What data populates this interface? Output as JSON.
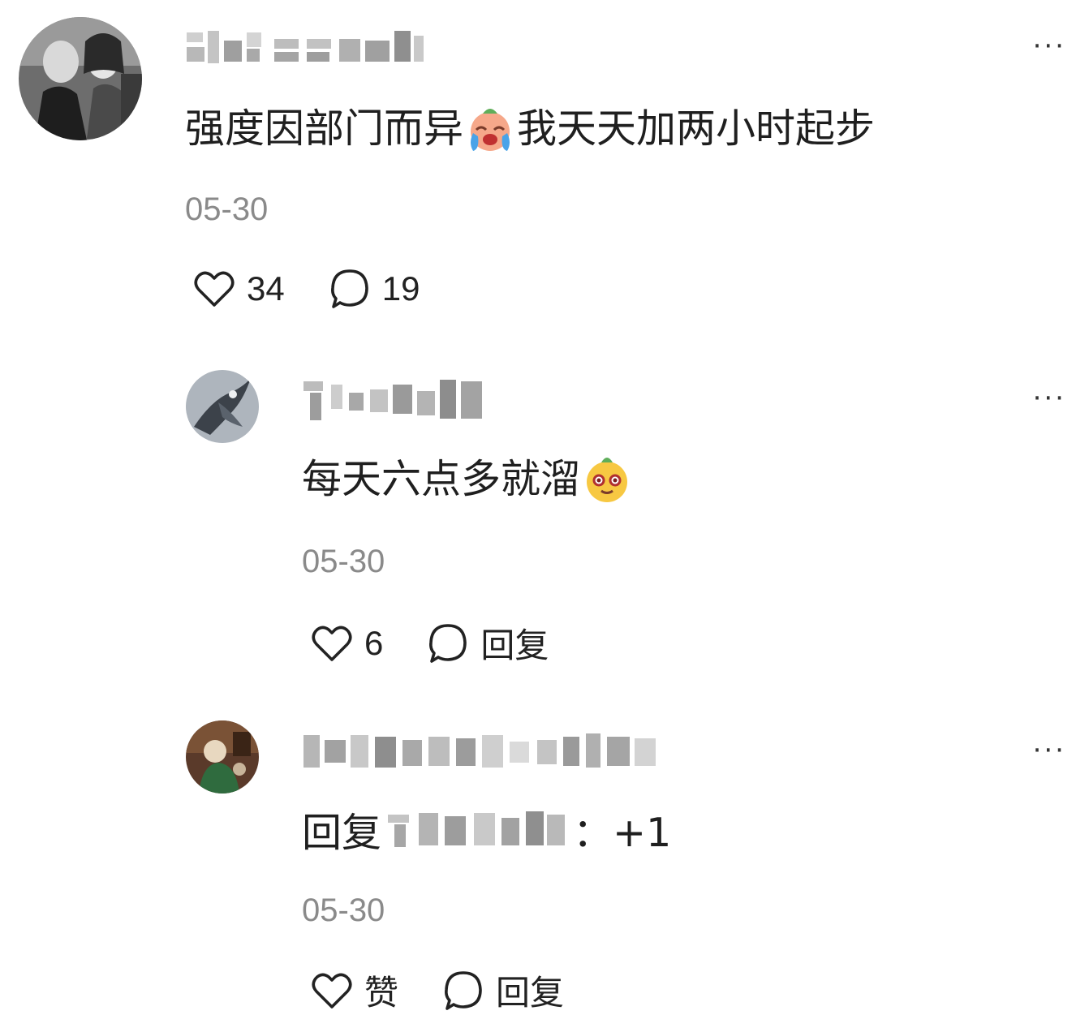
{
  "comments": [
    {
      "avatar_icon": "avatar-bw-photo",
      "text_before_emoji": "强度因部门而异",
      "emoji": "crying-face-emoji",
      "text_after_emoji": "我天天加两小时起步",
      "date": "05-30",
      "like_count": "34",
      "reply_count": "19",
      "more_label": "···"
    },
    {
      "avatar_icon": "avatar-dragon",
      "text_before_emoji": "每天六点多就溜",
      "emoji": "sly-face-emoji",
      "date": "05-30",
      "like_count": "6",
      "reply_label": "回复",
      "more_label": "···"
    },
    {
      "avatar_icon": "avatar-figure",
      "reply_prefix": "回复",
      "reply_suffix": "：+1",
      "date": "05-30",
      "like_label": "赞",
      "reply_label": "回复",
      "more_label": "···"
    }
  ],
  "icons": {
    "like": "heart-icon",
    "reply": "speech-bubble-icon",
    "more": "more-dots-icon"
  },
  "colors": {
    "date_gray": "#8a8a8a",
    "text": "#1f1f1f",
    "blur_gray": "#c7c7c7"
  }
}
